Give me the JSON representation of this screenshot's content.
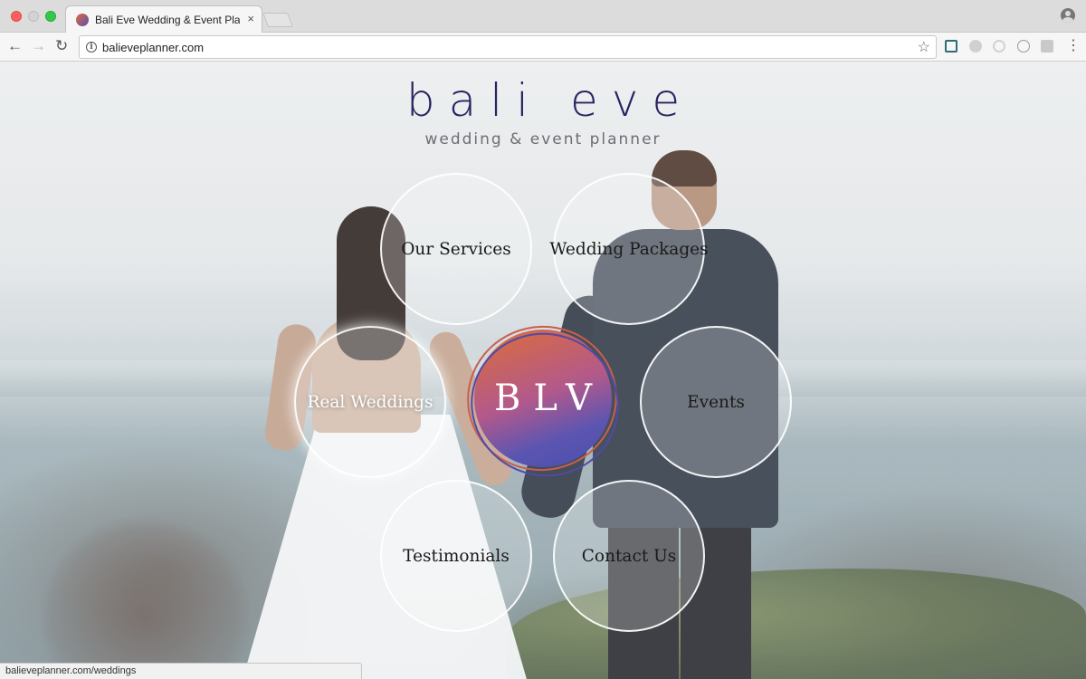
{
  "browser": {
    "tab_title": "Bali Eve Wedding & Event Planner",
    "tab_close": "×",
    "url": "balieveplanner.com",
    "status_url": "balieveplanner.com/weddings"
  },
  "site": {
    "logo_title": "bali eve",
    "logo_subtitle": "wedding & event planner",
    "center_badge": "BLV",
    "brand_colors": {
      "navy": "#2a2360",
      "orange": "#de6d37",
      "violet": "#4b4fae"
    },
    "menu": [
      {
        "label": "Our Services",
        "active": false
      },
      {
        "label": "Wedding Packages",
        "active": false
      },
      {
        "label": "Real Weddings",
        "active": true
      },
      {
        "label": "Events",
        "active": false
      },
      {
        "label": "Testimonials",
        "active": false
      },
      {
        "label": "Contact Us",
        "active": false
      }
    ]
  }
}
